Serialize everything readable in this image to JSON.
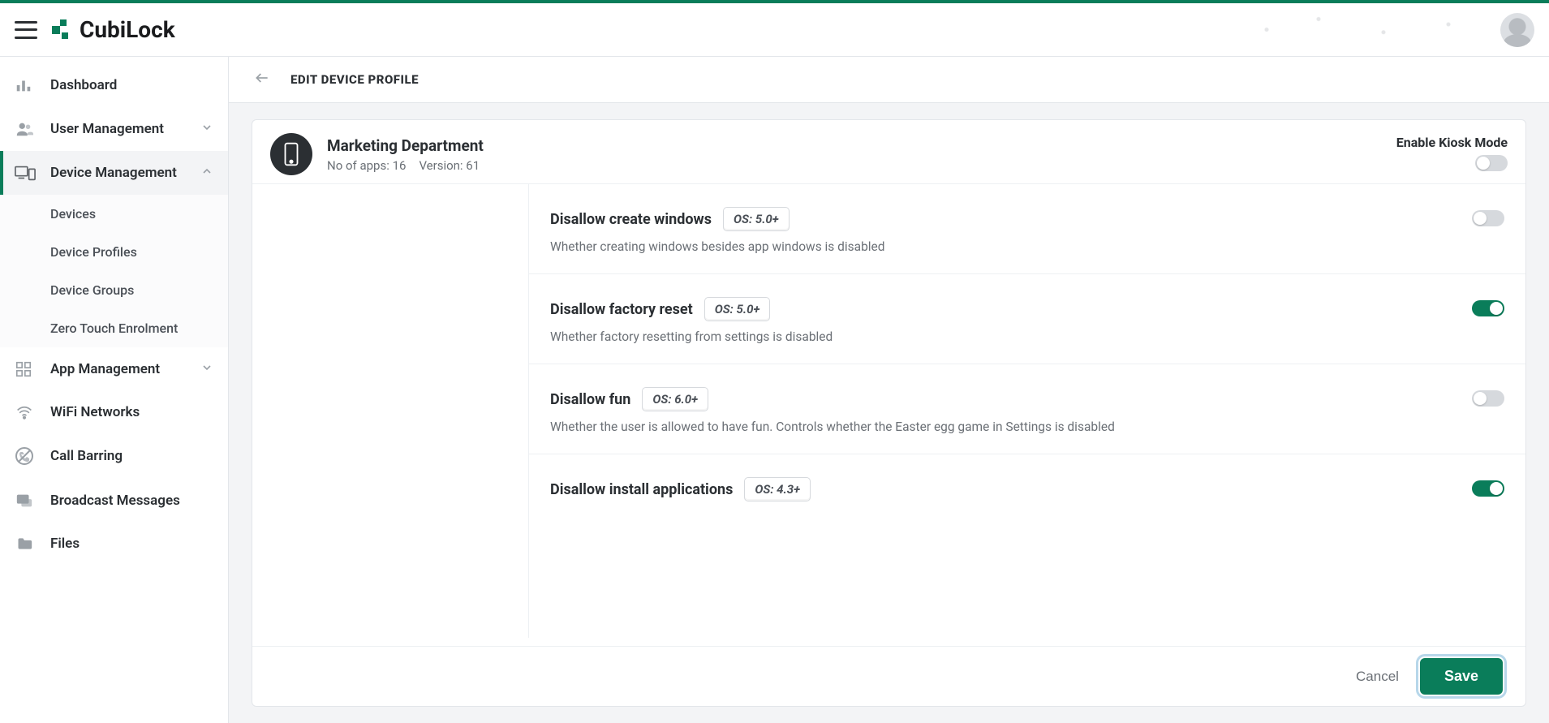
{
  "brand": {
    "name": "CubiLock"
  },
  "sidebar": {
    "items": [
      {
        "label": "Dashboard"
      },
      {
        "label": "User Management"
      },
      {
        "label": "Device Management"
      },
      {
        "label": "App Management"
      },
      {
        "label": "WiFi Networks"
      },
      {
        "label": "Call Barring"
      },
      {
        "label": "Broadcast Messages"
      },
      {
        "label": "Files"
      }
    ],
    "device_mgmt_sub": [
      {
        "label": "Devices"
      },
      {
        "label": "Device Profiles"
      },
      {
        "label": "Device Groups"
      },
      {
        "label": "Zero Touch Enrolment"
      }
    ]
  },
  "page": {
    "title": "EDIT DEVICE PROFILE"
  },
  "profile": {
    "name": "Marketing Department",
    "apps_label": "No of apps: 16",
    "version_label": "Version: 61",
    "kiosk_label": "Enable Kiosk Mode"
  },
  "settings": [
    {
      "name": "Disallow create windows",
      "os": "OS: 5.0+",
      "desc": "Whether creating windows besides app windows is disabled",
      "on": false
    },
    {
      "name": "Disallow factory reset",
      "os": "OS: 5.0+",
      "desc": "Whether factory resetting from settings is disabled",
      "on": true
    },
    {
      "name": "Disallow fun",
      "os": "OS: 6.0+",
      "desc": "Whether the user is allowed to have fun. Controls whether the Easter egg game in Settings is disabled",
      "on": false
    },
    {
      "name": "Disallow install applications",
      "os": "OS: 4.3+",
      "desc": "",
      "on": true
    }
  ],
  "footer": {
    "cancel": "Cancel",
    "save": "Save"
  }
}
